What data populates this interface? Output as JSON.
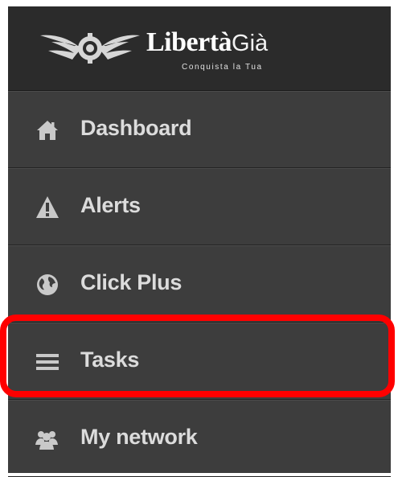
{
  "brand": {
    "name_bold": "Libertà",
    "name_light": "Già",
    "tagline": "Conquista la Tua"
  },
  "menu": {
    "items": [
      {
        "label": "Dashboard",
        "icon": "home-icon"
      },
      {
        "label": "Alerts",
        "icon": "warning-icon"
      },
      {
        "label": "Click Plus",
        "icon": "globe-icon"
      },
      {
        "label": "Tasks",
        "icon": "list-icon"
      },
      {
        "label": "My network",
        "icon": "users-icon"
      }
    ]
  },
  "highlight": {
    "target": "Tasks",
    "color": "#ff0000"
  },
  "colors": {
    "sidebar": "#3d3d3d",
    "logo_bar": "#2b2b2b",
    "text": "#dcdcdc",
    "icon": "#c9c9c9"
  }
}
